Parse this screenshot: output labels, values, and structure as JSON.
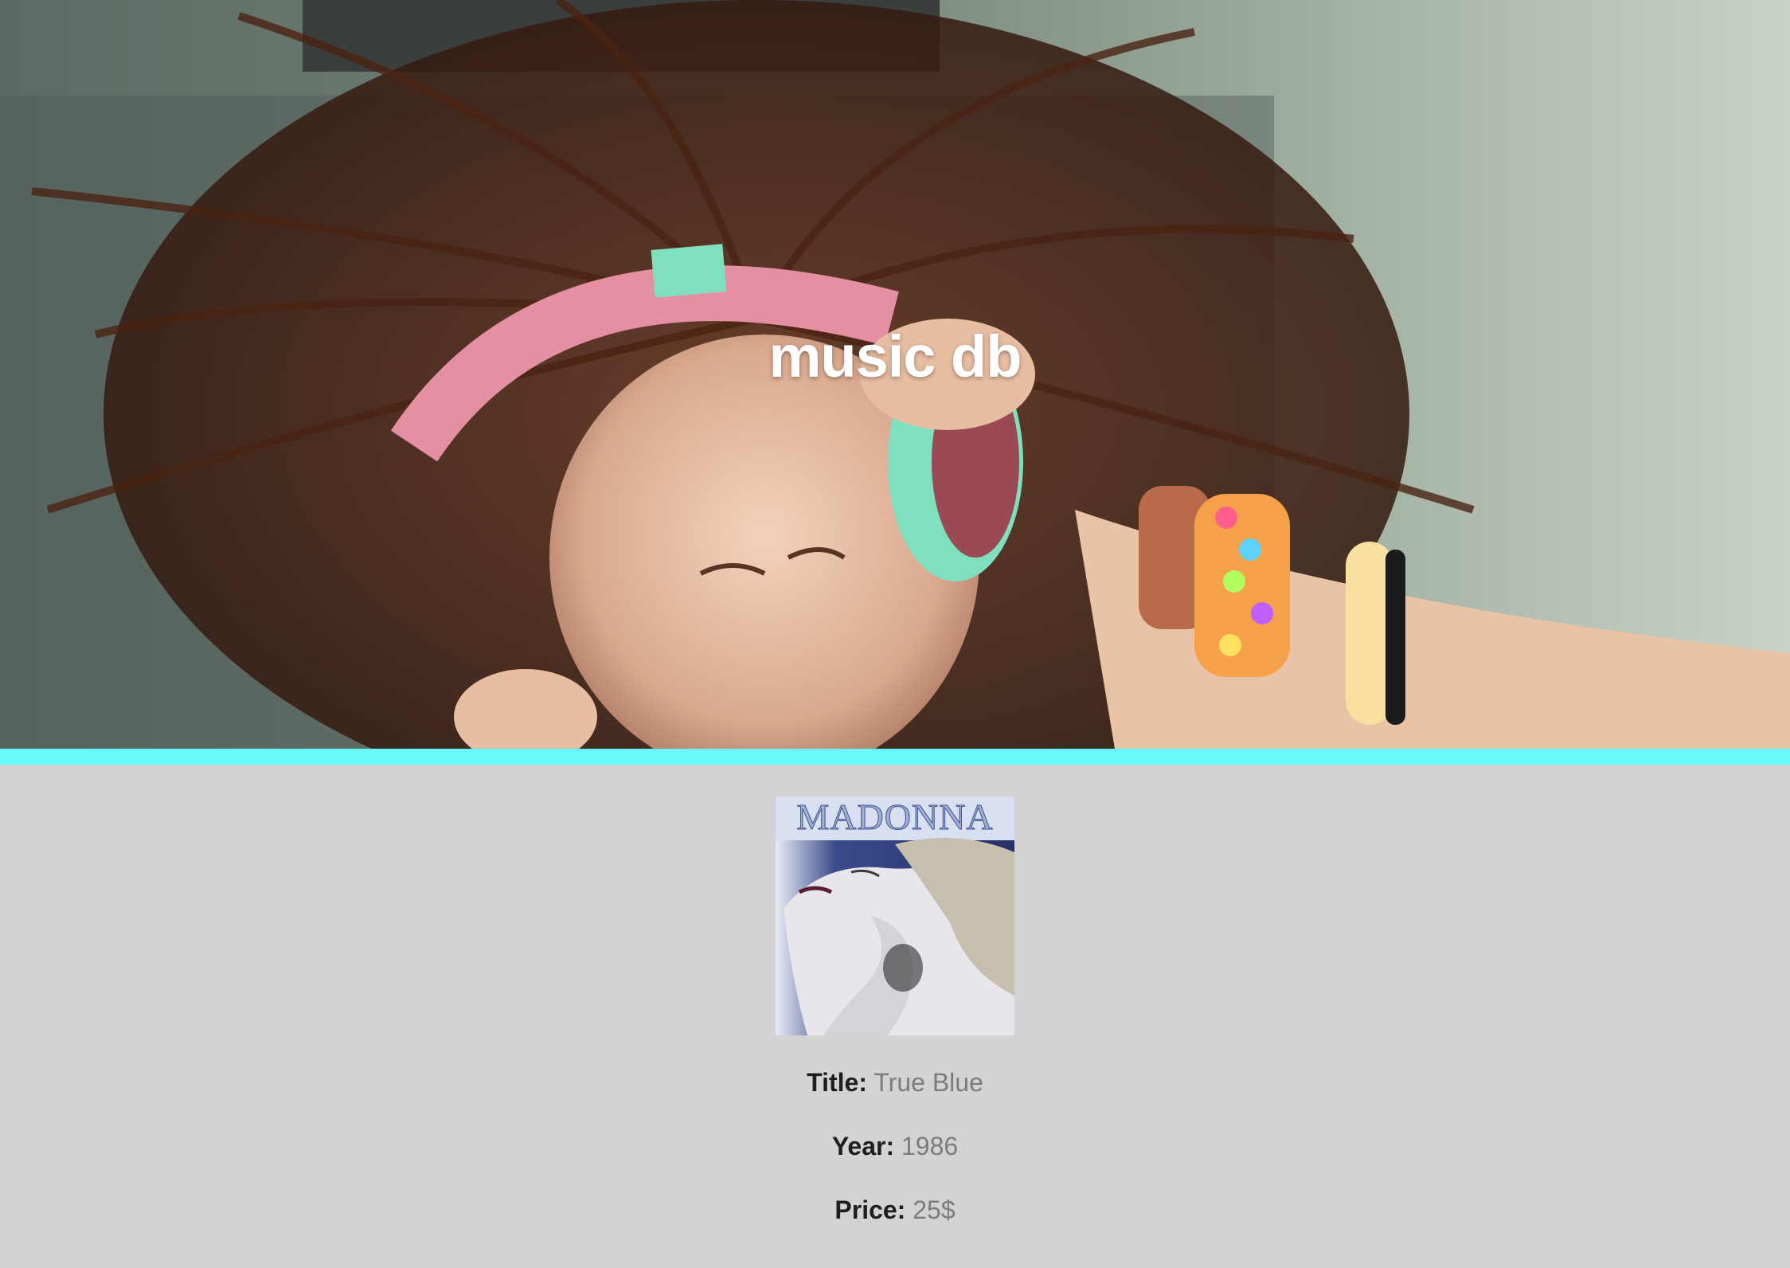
{
  "header": {
    "title": "music db",
    "hero_image": "girl-with-headphones-photo"
  },
  "colors": {
    "accent_bar": "#66fafa",
    "background": "#d3d3d3",
    "label": "#1e1e1e",
    "value": "#7c7c7c"
  },
  "album": {
    "cover_image": "album-cover-portrait",
    "cover_text": "MADONNA",
    "title_label": "Title:",
    "title_value": "True Blue",
    "year_label": "Year:",
    "year_value": "1986",
    "price_label": "Price:",
    "price_value": "25$"
  }
}
